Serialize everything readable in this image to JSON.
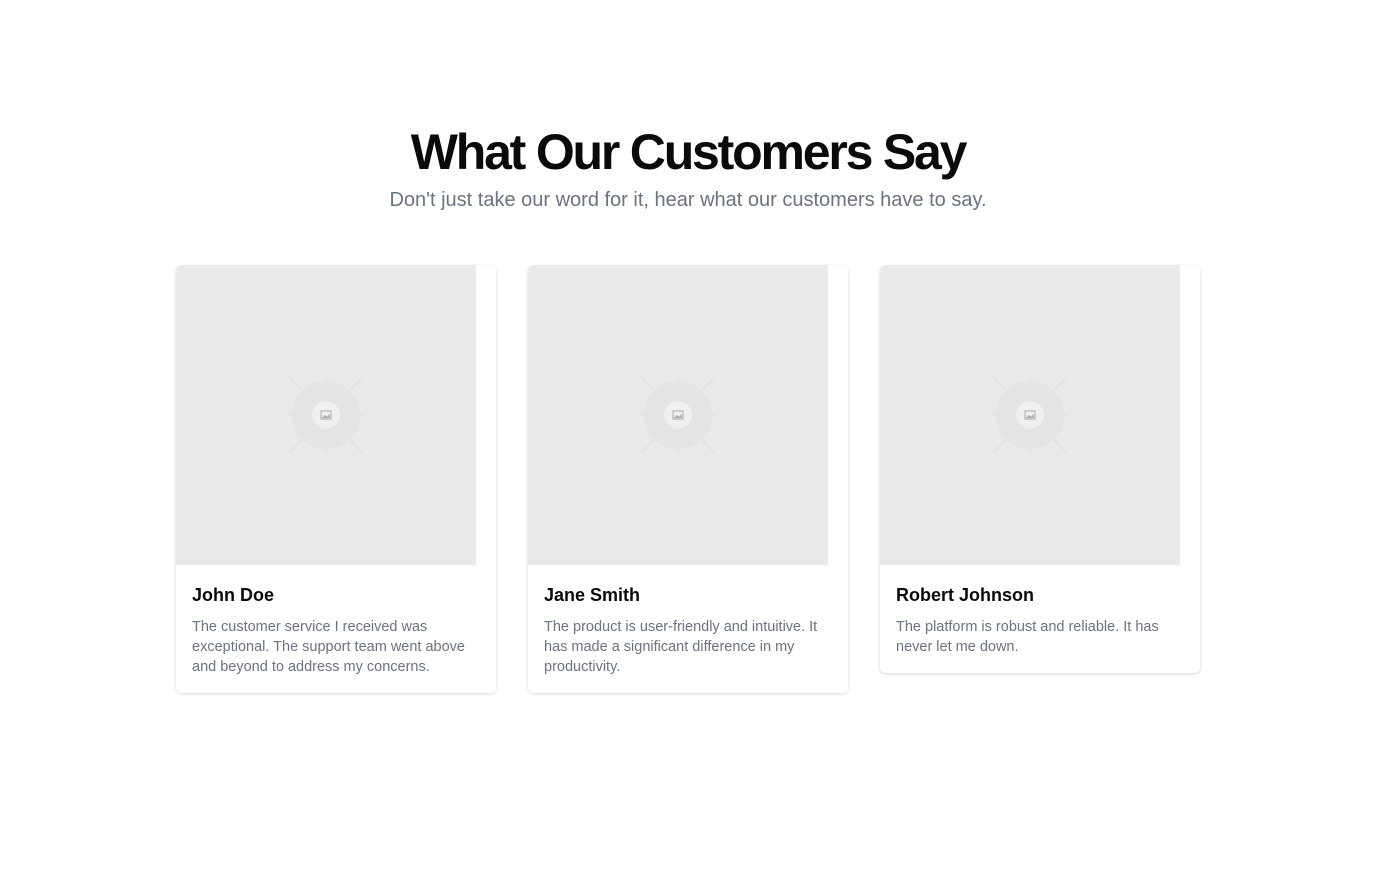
{
  "header": {
    "title": "What Our Customers Say",
    "subtitle": "Don't just take our word for it, hear what our customers have to say."
  },
  "testimonials": [
    {
      "name": "John Doe",
      "quote": "The customer service I received was exceptional. The support team went above and beyond to address my concerns.",
      "image_icon": "image-placeholder-icon"
    },
    {
      "name": "Jane Smith",
      "quote": "The product is user-friendly and intuitive. It has made a significant difference in my productivity.",
      "image_icon": "image-placeholder-icon"
    },
    {
      "name": "Robert Johnson",
      "quote": "The platform is robust and reliable. It has never let me down.",
      "image_icon": "image-placeholder-icon"
    }
  ],
  "colors": {
    "heading": "#0a0a0a",
    "muted_text": "#6b7280",
    "placeholder_bg": "#e9e9e9"
  }
}
